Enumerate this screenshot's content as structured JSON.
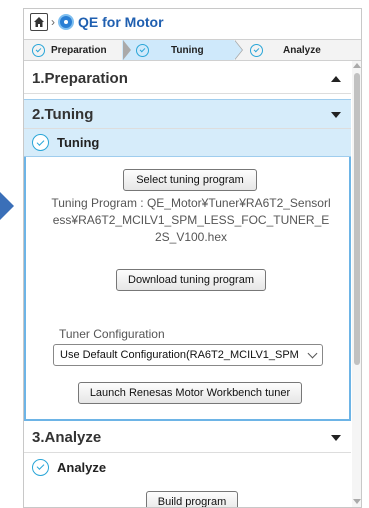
{
  "breadcrumb": {
    "title": "QE for Motor",
    "home_icon": "home-icon",
    "app_icon": "qe-logo-icon"
  },
  "steps": [
    {
      "label": "Preparation",
      "state": "done"
    },
    {
      "label": "Tuning",
      "state": "active"
    },
    {
      "label": "Analyze",
      "state": "done"
    }
  ],
  "sections": {
    "preparation": {
      "title": "1.Preparation",
      "expanded": false
    },
    "tuning": {
      "title": "2.Tuning",
      "expanded": true,
      "sub_title": "Tuning",
      "select_program_button": "Select tuning program",
      "program_text": "Tuning Program : QE_Motor¥Tuner¥RA6T2_Sensorless¥RA6T2_MCILV1_SPM_LESS_FOC_TUNER_E2S_V100.hex",
      "download_button": "Download tuning program",
      "config_label": "Tuner Configuration",
      "config_selected": "Use Default Configuration(RA6T2_MCILV1_SPM",
      "launch_button": "Launch Renesas Motor Workbench tuner"
    },
    "analyze": {
      "title": "3.Analyze",
      "expanded": true,
      "sub_title": "Analyze",
      "build_button": "Build program"
    }
  },
  "colors": {
    "accent": "#2aa6d8",
    "title": "#1f5fb0",
    "active_bg": "#d6ecfa",
    "side_arrow": "#3a6fb8"
  }
}
